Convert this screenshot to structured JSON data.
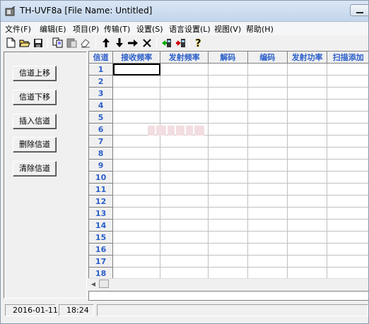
{
  "window": {
    "title": "TH-UVF8a [File Name: Untitled]"
  },
  "menu": [
    "文件(F)",
    "编辑(E)",
    "项目(P)",
    "传输(T)",
    "设置(S)",
    "语言设置(L)",
    "视图(V)",
    "帮助(H)"
  ],
  "toolbar": {
    "buttons": [
      "new-file-icon",
      "open-folder-icon",
      "save-icon",
      "copy-icon",
      "paste-icon",
      "erase-icon",
      "arrow-up-icon",
      "arrow-down-icon",
      "arrow-right-icon",
      "delete-x-icon",
      "read-from-radio-icon",
      "write-to-radio-icon",
      "help-icon"
    ]
  },
  "side_buttons": [
    "信道上移",
    "信道下移",
    "插入信道",
    "删除信道",
    "清除信道"
  ],
  "table": {
    "columns": [
      "信道",
      "接收频率",
      "发射频率",
      "解码",
      "编码",
      "发射功率",
      "扫描添加"
    ],
    "rows": [
      "1",
      "2",
      "3",
      "4",
      "5",
      "6",
      "7",
      "8",
      "9",
      "10",
      "11",
      "12",
      "13",
      "14",
      "15",
      "16",
      "17",
      "18"
    ]
  },
  "status": {
    "date": "2016-01-11",
    "time": "18:24"
  },
  "colors": {
    "header_text": "#2b5fc9",
    "chrome": "#f0f0f0"
  }
}
